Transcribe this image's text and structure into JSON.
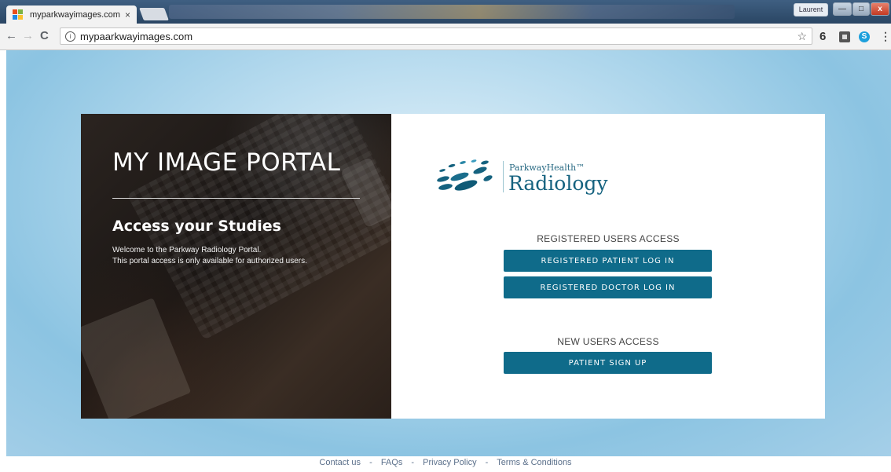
{
  "browser": {
    "tab_title": "myparkwayimages.com",
    "tab_close": "×",
    "url": "mypaarkwayimages.com",
    "profile": "Laurent",
    "back": "←",
    "forward": "→",
    "reload": "C",
    "info": "i",
    "star": "☆",
    "menu": "⋮",
    "ext_s": "S",
    "ext_6": "6",
    "win_min": "—",
    "win_max": "□",
    "win_close": "x"
  },
  "hero": {
    "title": "MY IMAGE PORTAL",
    "heading": "Access your Studies",
    "welcome": "Welcome to the Parkway Radiology Portal.",
    "note": "This portal access is only available for authorized users."
  },
  "logo": {
    "brand": "ParkwayHealth™",
    "product": "Radiology"
  },
  "registered": {
    "label": "REGISTERED USERS ACCESS",
    "patient_login": "REGISTERED PATIENT LOG IN",
    "doctor_login": "REGISTERED DOCTOR LOG IN"
  },
  "new_users": {
    "label": "NEW USERS ACCESS",
    "signup": "PATIENT SIGN UP"
  },
  "footer": {
    "contact": "Contact us",
    "faqs": "FAQs",
    "privacy": "Privacy Policy",
    "terms": "Terms & Conditions",
    "separator": "-"
  },
  "colors": {
    "accent": "#0f6b8a",
    "logo_teal": "#15627f"
  }
}
